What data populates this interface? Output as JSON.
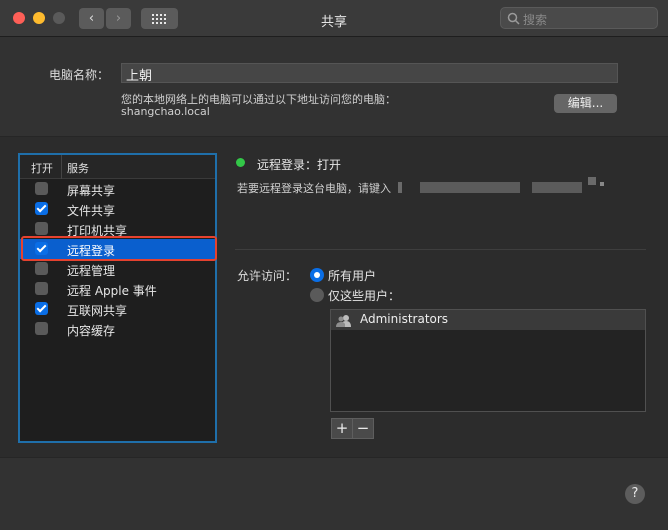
{
  "window": {
    "title": "共享",
    "search_placeholder": "搜索",
    "colors": {
      "close": "#fe5f57",
      "minimize": "#febb2e",
      "zoom": "#5a5a5a"
    }
  },
  "computer": {
    "name_label": "电脑名称：",
    "name_value": "上朝",
    "info_line": "您的本地网络上的电脑可以通过以下地址访问您的电脑：",
    "local_address": "shangchao.local",
    "edit_button": "编辑..."
  },
  "services": {
    "col_on": "打开",
    "col_service": "服务",
    "items": [
      {
        "label": "屏幕共享",
        "checked": false,
        "selected": false
      },
      {
        "label": "文件共享",
        "checked": true,
        "selected": false
      },
      {
        "label": "打印机共享",
        "checked": false,
        "selected": false
      },
      {
        "label": "远程登录",
        "checked": true,
        "selected": true
      },
      {
        "label": "远程管理",
        "checked": false,
        "selected": false
      },
      {
        "label": "远程 Apple 事件",
        "checked": false,
        "selected": false
      },
      {
        "label": "互联网共享",
        "checked": true,
        "selected": false
      },
      {
        "label": "内容缓存",
        "checked": false,
        "selected": false
      }
    ]
  },
  "detail": {
    "status": "远程登录：打开",
    "status_color": "#33c748",
    "instruction": "若要远程登录这台电脑，请键入",
    "access_label": "允许访问：",
    "option_all": "所有用户",
    "option_some": "仅这些用户：",
    "selected_option": "所有用户",
    "users": [
      {
        "name": "Administrators",
        "icon": "group-icon"
      }
    ],
    "add_label": "+",
    "remove_label": "−"
  },
  "help_label": "?"
}
